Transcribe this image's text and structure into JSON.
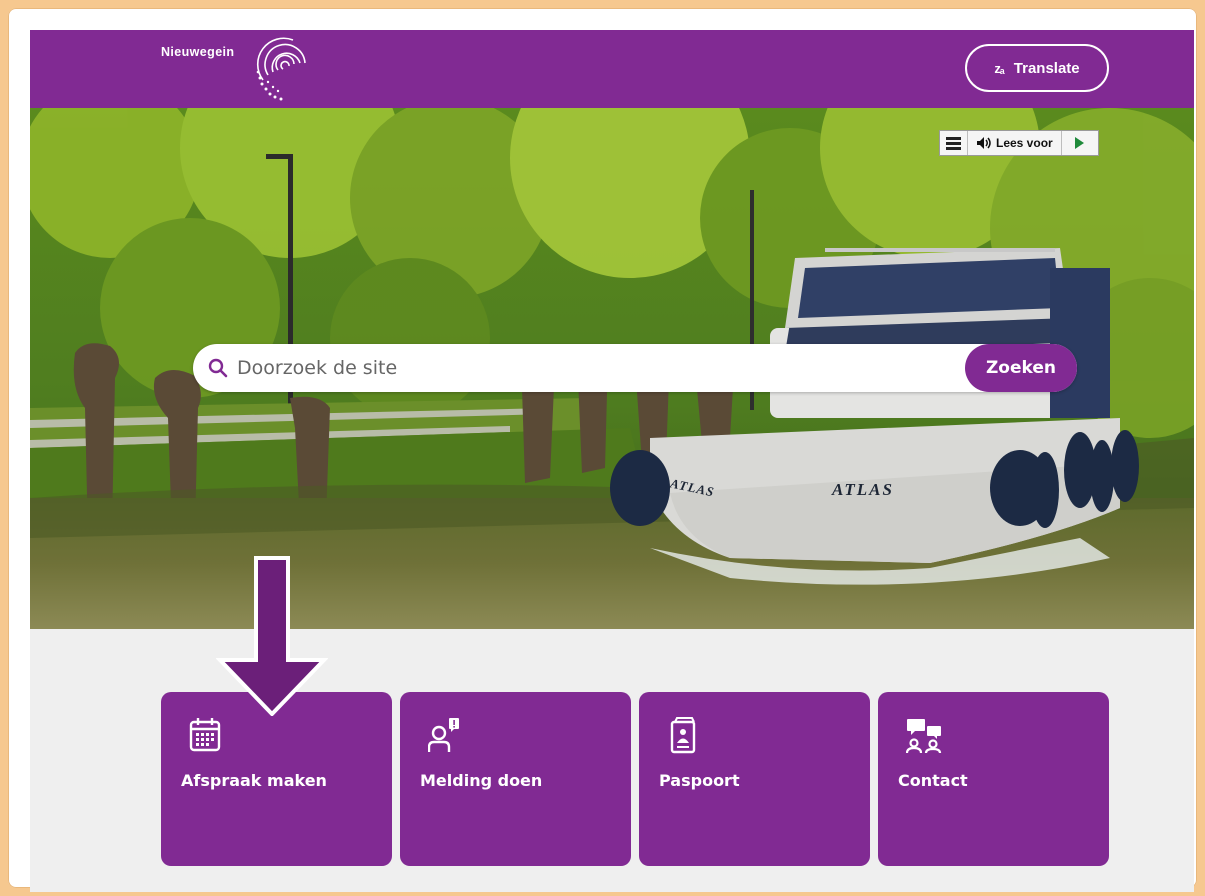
{
  "header": {
    "brand": "Nieuwegein",
    "translate_icon": "zₐ",
    "translate_label": "Translate",
    "bg_color": "#812a93"
  },
  "readspeaker": {
    "menu_icon": "hamburger-icon",
    "speaker_icon": "speaker-icon",
    "label": "Lees voor",
    "play_icon": "play-icon"
  },
  "search": {
    "placeholder": "Doorzoek de site",
    "value": "",
    "button_label": "Zoeken"
  },
  "hero": {
    "boat_name": "ATLAS"
  },
  "tiles": [
    {
      "label": "Afspraak maken",
      "icon": "calendar-icon"
    },
    {
      "label": "Melding doen",
      "icon": "person-report-icon"
    },
    {
      "label": "Paspoort",
      "icon": "passport-icon"
    },
    {
      "label": "Contact",
      "icon": "contact-chat-icon"
    }
  ],
  "annotation": {
    "icon": "down-arrow-icon",
    "color": "#6b1f79"
  }
}
